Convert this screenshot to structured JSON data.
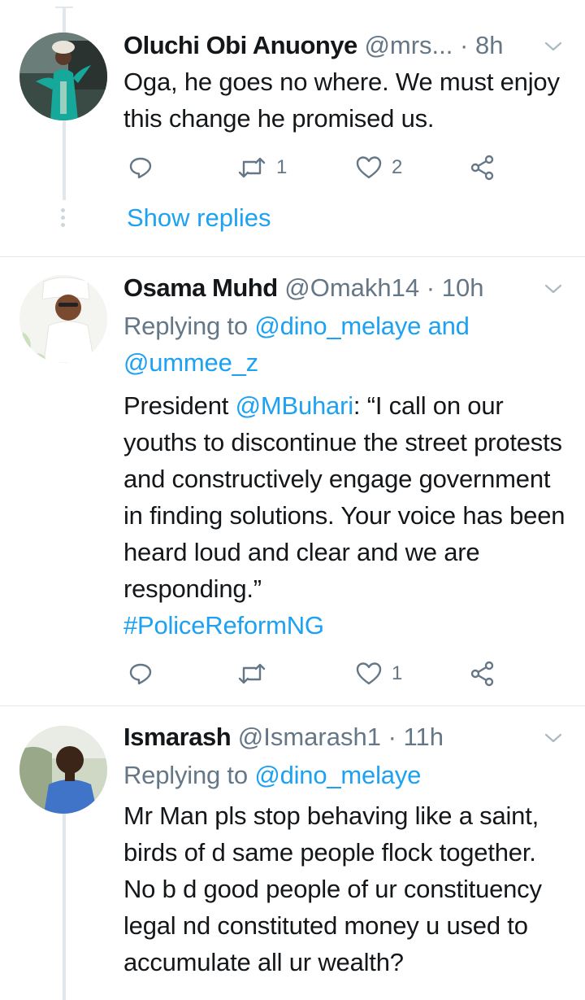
{
  "tweets": [
    {
      "name": "Oluchi Obi Anuonye",
      "handle": "@mrs...",
      "dot": " · ",
      "time": "8h",
      "text": "Oga, he goes no where. We must enjoy this change he promised us.",
      "retweets": "1",
      "likes": "2",
      "show_replies": "Show replies"
    },
    {
      "name": "Osama Muhd",
      "handle": "@Omakh14",
      "dot": " · ",
      "time": "10h",
      "replying_prefix": "Replying to ",
      "replying_user1": "@dino_melaye",
      "replying_and": " and",
      "replying_user2": "@ummee_z",
      "text_prefix": "President ",
      "mention": "@MBuhari",
      "text_rest": ": “I call on our youths to discontinue the street protests and constructively engage government in finding solutions. Your voice has been heard loud and clear and we are responding.”",
      "hashtag": "#PoliceReformNG",
      "retweets": "",
      "likes": "1"
    },
    {
      "name": "Ismarash",
      "handle": "@Ismarash1",
      "dot": " · ",
      "time": "11h",
      "replying_prefix": "Replying to ",
      "replying_user1": "@dino_melaye",
      "text": "Mr Man pls stop behaving like a saint, birds of d same people flock together. No b d good people of ur constituency legal nd constituted money u used to accumulate all ur wealth?"
    }
  ],
  "colors": {
    "link": "#1da1f2",
    "secondary": "#657786",
    "divider": "#e1e8ed"
  },
  "icons": [
    "reply-icon",
    "retweet-icon",
    "like-icon",
    "share-icon",
    "chevron-down-icon"
  ]
}
